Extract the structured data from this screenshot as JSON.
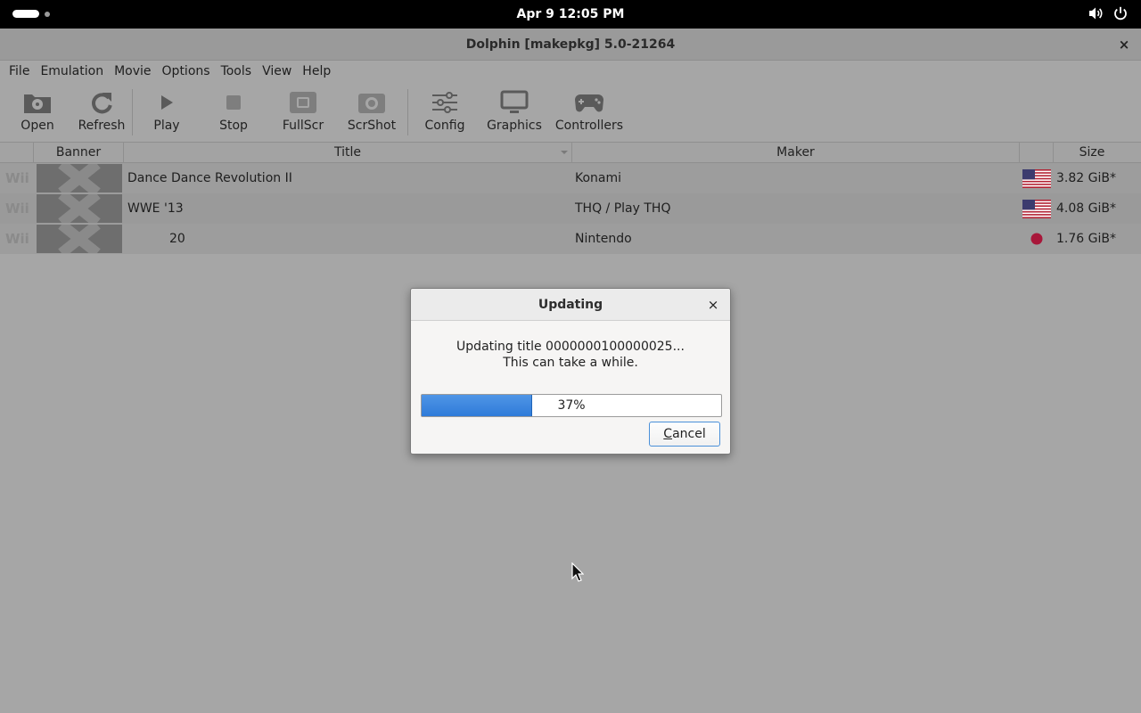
{
  "system_bar": {
    "clock": "Apr 9  12:05 PM",
    "tray_icons": [
      "volume-icon",
      "power-icon"
    ]
  },
  "window": {
    "title": "Dolphin [makepkg] 5.0-21264",
    "close_glyph": "×"
  },
  "menu": [
    "File",
    "Emulation",
    "Movie",
    "Options",
    "Tools",
    "View",
    "Help"
  ],
  "toolbar": [
    {
      "label": "Open",
      "icon": "disc-folder-icon"
    },
    {
      "label": "Refresh",
      "icon": "refresh-icon"
    },
    {
      "label": "Play",
      "icon": "play-icon"
    },
    {
      "label": "Stop",
      "icon": "stop-icon"
    },
    {
      "label": "FullScr",
      "icon": "fullscreen-icon"
    },
    {
      "label": "ScrShot",
      "icon": "camera-icon"
    },
    {
      "label": "Config",
      "icon": "sliders-icon"
    },
    {
      "label": "Graphics",
      "icon": "monitor-icon"
    },
    {
      "label": "Controllers",
      "icon": "gamepad-icon"
    }
  ],
  "table": {
    "headers": {
      "banner": "Banner",
      "title": "Title",
      "maker": "Maker",
      "region": "",
      "size": "Size"
    },
    "rows": [
      {
        "platform": "Wii",
        "title": "Dance Dance Revolution II",
        "maker": "Konami",
        "region": "us-flag",
        "size": "3.82 GiB*"
      },
      {
        "platform": "Wii",
        "title": "WWE '13",
        "maker": "THQ / Play THQ",
        "region": "us-flag",
        "size": "4.08 GiB*"
      },
      {
        "platform": "Wii",
        "title": "20",
        "maker": "Nintendo",
        "region": "japan-flag",
        "size": "1.76 GiB*"
      }
    ]
  },
  "dialog": {
    "title": "Updating",
    "message_line1": "Updating title 0000000100000025...",
    "message_line2": "This can take a while.",
    "progress": 0.37,
    "progress_text": "37%",
    "cancel_label": "Cancel",
    "accent": "#3584e4"
  }
}
